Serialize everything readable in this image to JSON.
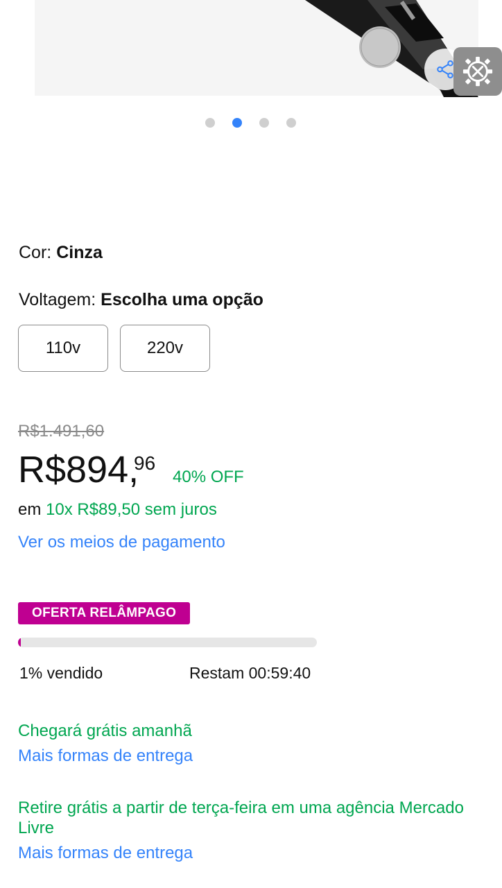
{
  "carousel": {
    "total": 4,
    "active_index": 1
  },
  "icons": {
    "share": "share-icon",
    "settings": "wrench-gear-icon"
  },
  "variants": {
    "color_label": "Cor:",
    "color_value": "Cinza",
    "voltage_label": "Voltagem:",
    "voltage_value": "Escolha uma opção",
    "options": [
      "110v",
      "220v"
    ]
  },
  "pricing": {
    "old_price": "R$1.491,60",
    "price_main": "R$894,",
    "price_cents": "96",
    "discount": "40% OFF",
    "installments_prefix": "em",
    "installments_value": "10x R$89,50 sem juros",
    "payment_link": "Ver os meios de pagamento"
  },
  "flash_sale": {
    "badge": "OFERTA RELÂMPAGO",
    "sold_fraction": 0.01,
    "sold_text": "1% vendido",
    "remaining_text": "Restam 00:59:40"
  },
  "shipping": {
    "delivery": "Chegará grátis amanhã",
    "delivery_link": "Mais formas de entrega",
    "pickup": "Retire grátis a partir de terça-feira em uma agência Mercado Livre",
    "pickup_link": "Mais formas de entrega"
  },
  "colors": {
    "accent_blue": "#3483fa",
    "green": "#00a650",
    "flash_magenta": "#bf0091"
  }
}
